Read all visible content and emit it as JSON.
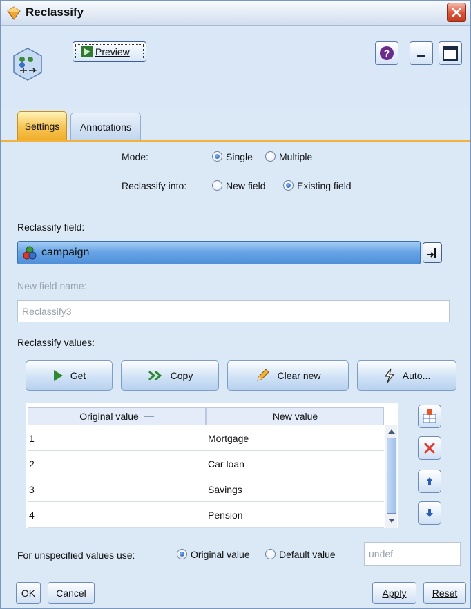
{
  "window": {
    "title": "Reclassify"
  },
  "toolbar": {
    "preview_label": "Preview"
  },
  "tabs": [
    {
      "label": "Settings",
      "active": true
    },
    {
      "label": "Annotations",
      "active": false
    }
  ],
  "settings": {
    "mode_label": "Mode:",
    "mode_options": [
      "Single",
      "Multiple"
    ],
    "mode_selected": "Single",
    "into_label": "Reclassify into:",
    "into_options": [
      "New field",
      "Existing field"
    ],
    "into_selected": "Existing field",
    "field_label": "Reclassify field:",
    "field_value": "campaign",
    "new_field_label": "New field name:",
    "new_field_value": "Reclassify3",
    "values_label": "Reclassify values:"
  },
  "value_buttons": {
    "get": "Get",
    "copy": "Copy",
    "clear_new": "Clear new",
    "auto": "Auto..."
  },
  "table": {
    "columns": [
      "Original value",
      "New value"
    ],
    "rows": [
      {
        "original": "1",
        "new": "Mortgage"
      },
      {
        "original": "2",
        "new": "Car loan"
      },
      {
        "original": "3",
        "new": "Savings"
      },
      {
        "original": "4",
        "new": "Pension"
      }
    ]
  },
  "unspecified": {
    "label": "For unspecified values use:",
    "options": [
      "Original value",
      "Default value"
    ],
    "selected": "Original value",
    "default_value": "undef"
  },
  "footer": {
    "ok": "OK",
    "cancel": "Cancel",
    "apply": "Apply",
    "reset": "Reset"
  },
  "colors": {
    "accent_tab": "#f6c453",
    "field_bar": "#6aa6e6",
    "window_bg": "#dbe9f7"
  }
}
